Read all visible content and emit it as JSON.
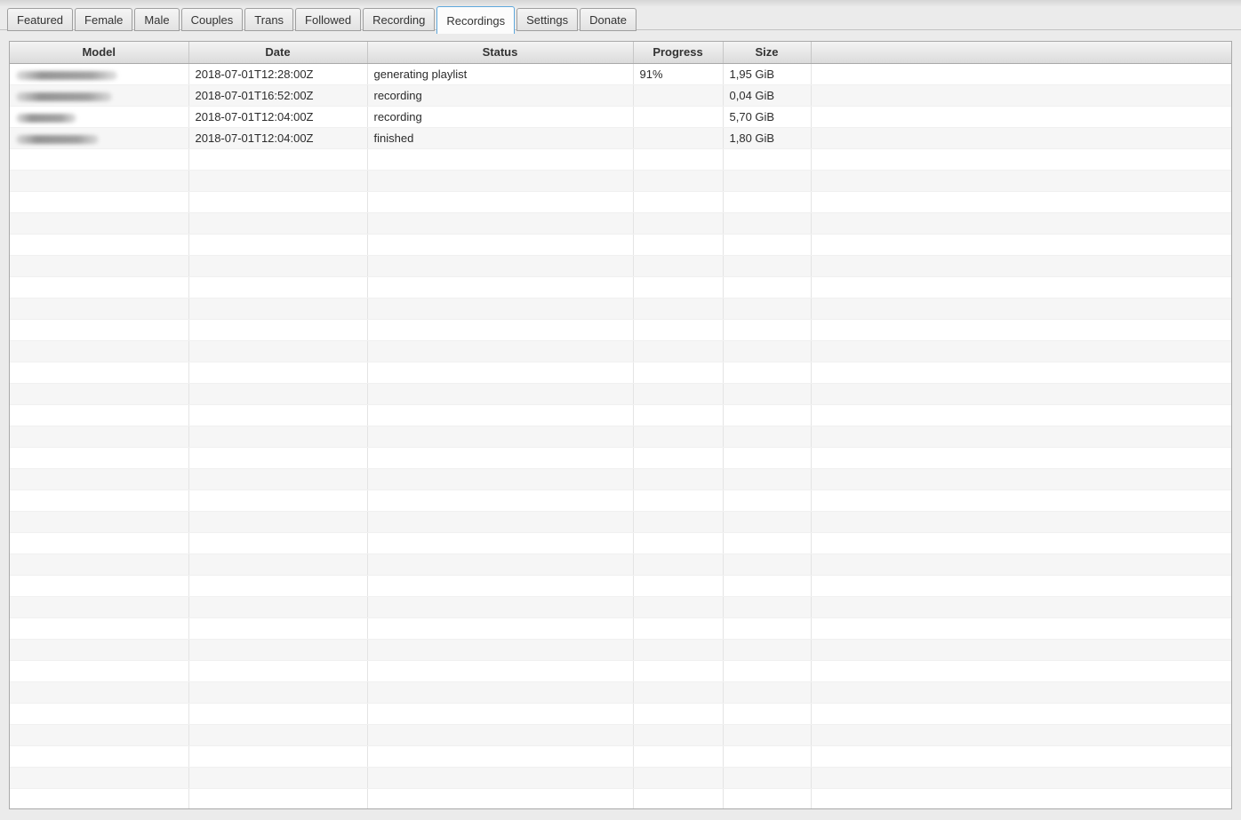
{
  "window": {
    "background_color": "#ebebeb",
    "accent_color": "#5fa8dc"
  },
  "tabs": {
    "items": [
      {
        "label": "Featured",
        "active": false
      },
      {
        "label": "Female",
        "active": false
      },
      {
        "label": "Male",
        "active": false
      },
      {
        "label": "Couples",
        "active": false
      },
      {
        "label": "Trans",
        "active": false
      },
      {
        "label": "Followed",
        "active": false
      },
      {
        "label": "Recording",
        "active": false
      },
      {
        "label": "Recordings",
        "active": true
      },
      {
        "label": "Settings",
        "active": false
      },
      {
        "label": "Donate",
        "active": false
      }
    ],
    "active_label": "Recordings"
  },
  "table": {
    "columns": [
      "Model",
      "Date",
      "Status",
      "Progress",
      "Size",
      ""
    ],
    "rows": [
      {
        "model": "",
        "model_redacted": true,
        "model_blur_width": 114,
        "date": "2018-07-01T12:28:00Z",
        "status": "generating playlist",
        "progress": "91%",
        "size": "1,95 GiB"
      },
      {
        "model": "",
        "model_redacted": true,
        "model_blur_width": 108,
        "date": "2018-07-01T16:52:00Z",
        "status": "recording",
        "progress": "",
        "size": "0,04 GiB"
      },
      {
        "model": "",
        "model_redacted": true,
        "model_blur_width": 68,
        "date": "2018-07-01T12:04:00Z",
        "status": "recording",
        "progress": "",
        "size": "5,70 GiB"
      },
      {
        "model": "",
        "model_redacted": true,
        "model_blur_width": 93,
        "date": "2018-07-01T12:04:00Z",
        "status": "finished",
        "progress": "",
        "size": "1,80 GiB"
      }
    ],
    "visible_row_count": 35,
    "header_colors": {
      "gradient_top": "#f4f4f4",
      "gradient_bottom": "#dbdbdb"
    },
    "stripe_color": "#f6f6f6"
  }
}
